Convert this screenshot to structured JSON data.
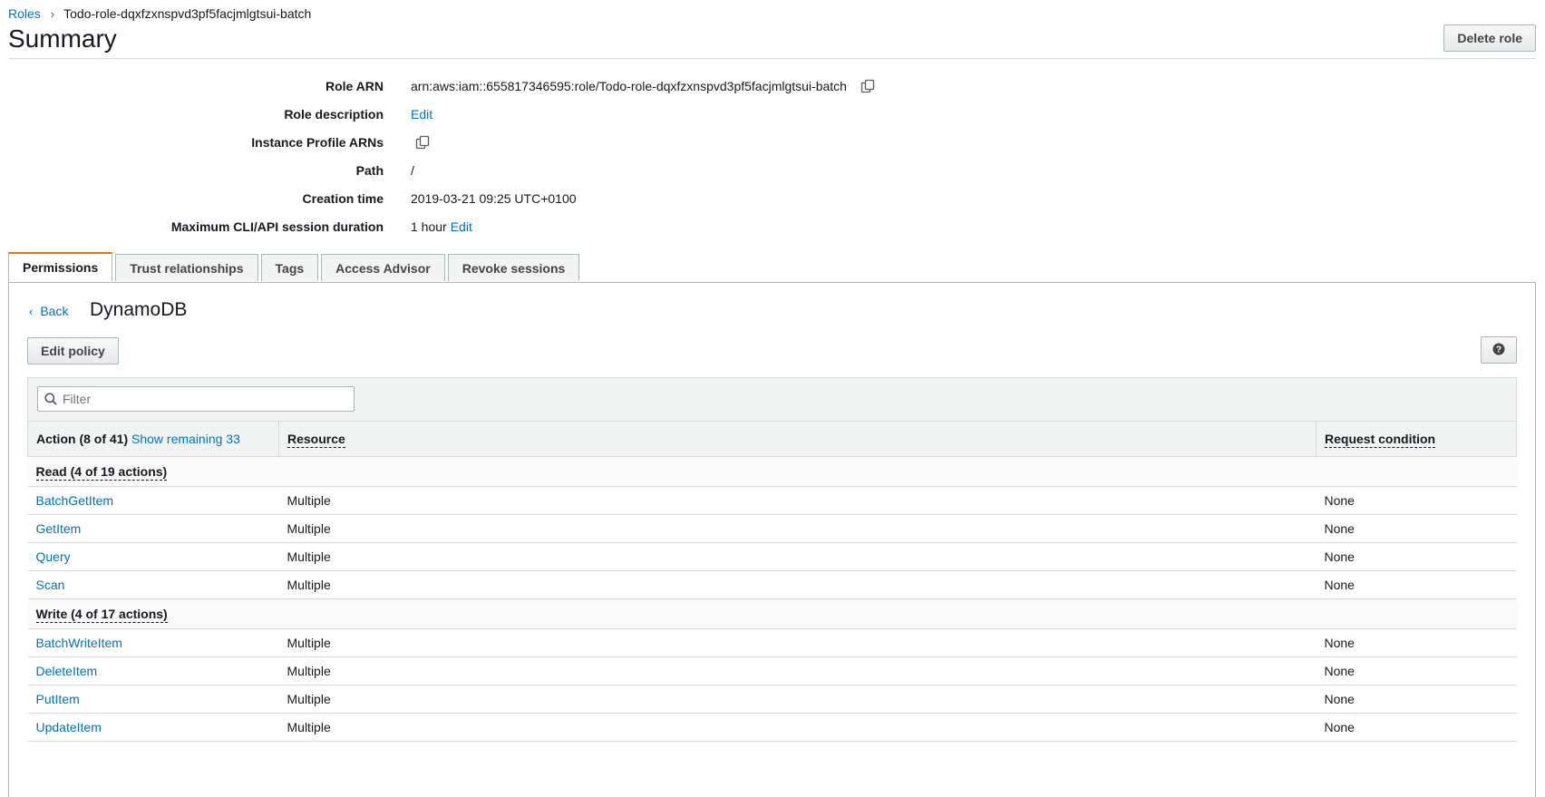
{
  "breadcrumb": {
    "parent": "Roles",
    "current": "Todo-role-dqxfzxnspvd3pf5facjmlgtsui-batch"
  },
  "page": {
    "title": "Summary",
    "delete_label": "Delete role"
  },
  "summary": {
    "role_arn_label": "Role ARN",
    "role_arn_value": "arn:aws:iam::655817346595:role/Todo-role-dqxfzxnspvd3pf5facjmlgtsui-batch",
    "role_description_label": "Role description",
    "role_description_edit": "Edit",
    "instance_profile_label": "Instance Profile ARNs",
    "path_label": "Path",
    "path_value": "/",
    "creation_time_label": "Creation time",
    "creation_time_value": "2019-03-21 09:25 UTC+0100",
    "session_duration_label": "Maximum CLI/API session duration",
    "session_duration_value": "1 hour",
    "session_duration_edit": "Edit"
  },
  "tabs": [
    "Permissions",
    "Trust relationships",
    "Tags",
    "Access Advisor",
    "Revoke sessions"
  ],
  "policy": {
    "back_label": "Back",
    "title": "DynamoDB",
    "edit_label": "Edit policy",
    "filter_placeholder": "Filter"
  },
  "table": {
    "col_action": "Action (8 of 41)",
    "show_remaining": "Show remaining 33",
    "col_resource": "Resource",
    "col_condition": "Request condition",
    "groups": [
      {
        "label": "Read (4 of 19 actions)",
        "rows": [
          {
            "action": "BatchGetItem",
            "resource": "Multiple",
            "condition": "None"
          },
          {
            "action": "GetItem",
            "resource": "Multiple",
            "condition": "None"
          },
          {
            "action": "Query",
            "resource": "Multiple",
            "condition": "None"
          },
          {
            "action": "Scan",
            "resource": "Multiple",
            "condition": "None"
          }
        ]
      },
      {
        "label": "Write (4 of 17 actions)",
        "rows": [
          {
            "action": "BatchWriteItem",
            "resource": "Multiple",
            "condition": "None"
          },
          {
            "action": "DeleteItem",
            "resource": "Multiple",
            "condition": "None"
          },
          {
            "action": "PutItem",
            "resource": "Multiple",
            "condition": "None"
          },
          {
            "action": "UpdateItem",
            "resource": "Multiple",
            "condition": "None"
          }
        ]
      }
    ]
  },
  "colors": {
    "link": "#0073bb",
    "active_tab_accent": "#ec7211"
  },
  "icons": {
    "copy": "copy-icon",
    "search": "search-icon",
    "help": "question-circle-icon",
    "back": "chevron-left-icon"
  }
}
